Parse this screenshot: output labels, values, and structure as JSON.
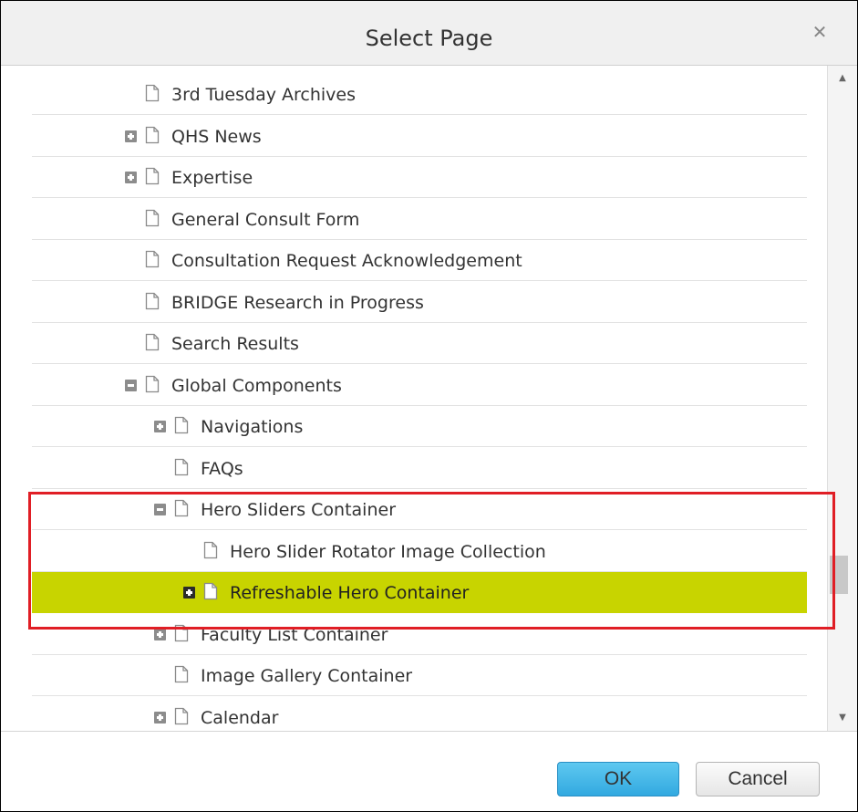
{
  "dialog": {
    "title": "Select Page",
    "close_icon": "close-icon"
  },
  "tree": {
    "items": [
      {
        "label": "3rd Tuesday Archives",
        "level": 1,
        "expander": "none",
        "selected": false
      },
      {
        "label": "QHS News",
        "level": 1,
        "expander": "plus",
        "selected": false
      },
      {
        "label": "Expertise",
        "level": 1,
        "expander": "plus",
        "selected": false
      },
      {
        "label": "General Consult Form",
        "level": 1,
        "expander": "none",
        "selected": false
      },
      {
        "label": "Consultation Request Acknowledgement",
        "level": 1,
        "expander": "none",
        "selected": false
      },
      {
        "label": "BRIDGE Research in Progress",
        "level": 1,
        "expander": "none",
        "selected": false
      },
      {
        "label": "Search Results",
        "level": 1,
        "expander": "none",
        "selected": false
      },
      {
        "label": "Global Components",
        "level": 1,
        "expander": "minus",
        "selected": false
      },
      {
        "label": "Navigations",
        "level": 2,
        "expander": "plus",
        "selected": false
      },
      {
        "label": "FAQs",
        "level": 2,
        "expander": "none",
        "selected": false
      },
      {
        "label": "Hero Sliders Container",
        "level": 2,
        "expander": "minus",
        "selected": false
      },
      {
        "label": "Hero Slider Rotator Image Collection",
        "level": 3,
        "expander": "none",
        "selected": false
      },
      {
        "label": "Refreshable Hero Container",
        "level": 3,
        "expander": "plus",
        "selected": true
      },
      {
        "label": "Faculty List Container",
        "level": 2,
        "expander": "plus",
        "selected": false
      },
      {
        "label": "Image Gallery Container",
        "level": 2,
        "expander": "none",
        "selected": false
      },
      {
        "label": "Calendar",
        "level": 2,
        "expander": "plus",
        "selected": false
      }
    ]
  },
  "scrollbar": {
    "up_arrow": "▲",
    "down_arrow": "▼"
  },
  "footer": {
    "ok_label": "OK",
    "cancel_label": "Cancel"
  },
  "colors": {
    "selected_row": "#c8d400",
    "highlight_border": "#e01e25",
    "ok_button": "#4dbbec"
  }
}
